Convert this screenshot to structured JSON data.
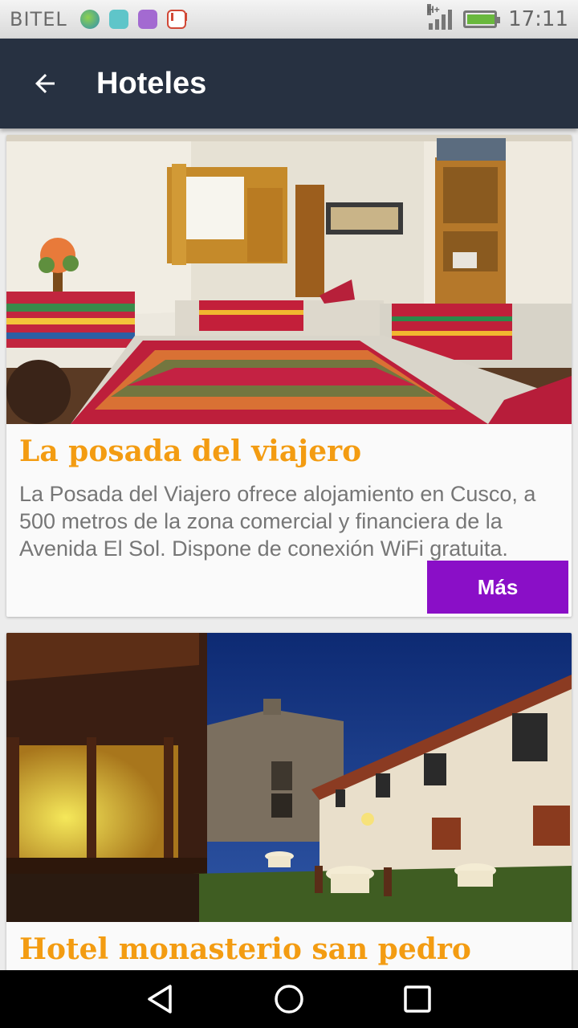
{
  "status_bar": {
    "carrier": "BITEL",
    "network": "H+",
    "time": "17:11",
    "notification_icons": [
      "globe-icon",
      "android-icon",
      "gallery-icon",
      "gmail-icon"
    ]
  },
  "app_bar": {
    "title": "Hoteles",
    "background": "#273141"
  },
  "hotels": [
    {
      "title": "La posada del viajero",
      "description": "La Posada del Viajero ofrece alojamiento en Cusco, a 500 metros de la zona comercial y financiera de la Avenida El Sol. Dispone de conexión WiFi gratuita.",
      "button_label": "Más",
      "photo": "hotel-room-photo"
    },
    {
      "title": "Hotel monasterio san pedro",
      "photo": "hotel-courtyard-night-photo"
    }
  ],
  "colors": {
    "title": "#f39c12",
    "button": "#8a0fc7",
    "app_bar": "#273141"
  }
}
